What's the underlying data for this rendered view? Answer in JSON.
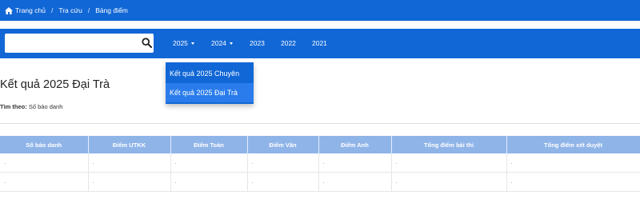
{
  "breadcrumb": {
    "home": "Trang chủ",
    "lookup": "Tra cứu",
    "current": "Bảng điểm"
  },
  "search": {
    "value": "",
    "placeholder": ""
  },
  "nav": {
    "items": [
      {
        "label": "2025",
        "has_dropdown": true
      },
      {
        "label": "2024",
        "has_dropdown": true
      },
      {
        "label": "2023",
        "has_dropdown": false
      },
      {
        "label": "2022",
        "has_dropdown": false
      },
      {
        "label": "2021",
        "has_dropdown": false
      }
    ]
  },
  "dropdown": {
    "items": [
      {
        "label": "Kết quả 2025 Chuyên",
        "active": false
      },
      {
        "label": "Kết quả 2025 Đại Trà",
        "active": true
      }
    ]
  },
  "page": {
    "title": "Kết quả 2025 Đại Trà",
    "search_by_label": "Tìm theo:",
    "search_by_value": "Số báo danh"
  },
  "table": {
    "headers": [
      "Số báo danh",
      "Điểm UTKK",
      "Điểm Toán",
      "Điểm Văn",
      "Điểm Anh",
      "Tổng điểm bài thi",
      "Tổng điểm xét duyệt"
    ],
    "rows": [
      [
        ".",
        ".",
        ".",
        ".",
        ".",
        ".",
        "."
      ],
      [
        ".",
        ".",
        ".",
        ".",
        ".",
        ".",
        "."
      ]
    ]
  },
  "colors": {
    "primary": "#1167d6",
    "dropdown_active": "#2a7cec",
    "table_header": "#8fb4e8"
  },
  "icons": {
    "home": "home-icon",
    "search": "search-icon",
    "caret": "caret-down-icon"
  }
}
